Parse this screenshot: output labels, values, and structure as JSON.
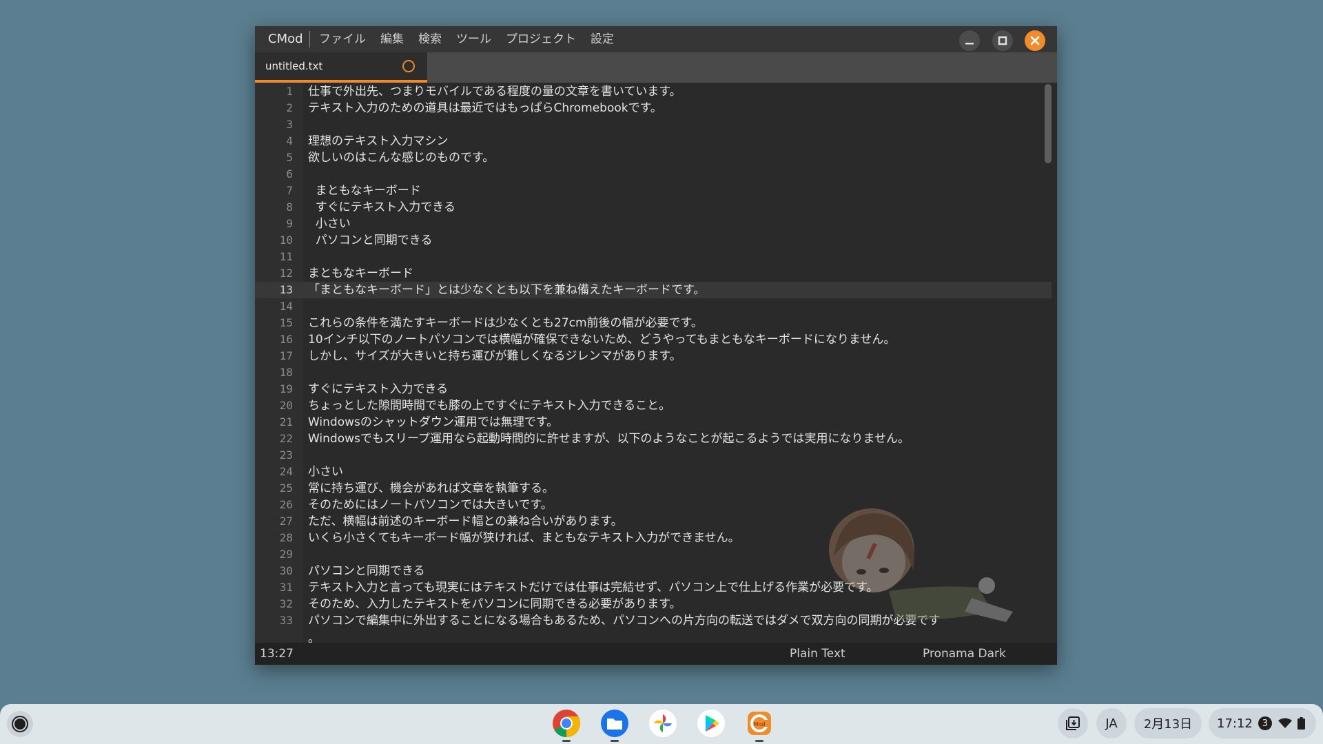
{
  "window": {
    "app_name": "CMod",
    "menu": [
      "ファイル",
      "編集",
      "検索",
      "ツール",
      "プロジェクト",
      "設定"
    ],
    "controls": {
      "minimize": "minimize-icon",
      "maximize": "maximize-icon",
      "close": "close-icon"
    }
  },
  "tabs": [
    {
      "title": "untitled.txt",
      "modified_indicator": "circle-icon"
    }
  ],
  "editor": {
    "current_line": 13,
    "lines": [
      {
        "n": "1",
        "text": "仕事で外出先、つまりモバイルである程度の量の文章を書いています。"
      },
      {
        "n": "2",
        "text": "テキスト入力のための道具は最近ではもっぱらChromebookです。"
      },
      {
        "n": "3",
        "text": ""
      },
      {
        "n": "4",
        "text": "理想のテキスト入力マシン"
      },
      {
        "n": "5",
        "text": "欲しいのはこんな感じのものです。"
      },
      {
        "n": "6",
        "text": ""
      },
      {
        "n": "7",
        "text": "  まともなキーボード"
      },
      {
        "n": "8",
        "text": "  すぐにテキスト入力できる"
      },
      {
        "n": "9",
        "text": "  小さい"
      },
      {
        "n": "10",
        "text": "  パソコンと同期できる"
      },
      {
        "n": "11",
        "text": ""
      },
      {
        "n": "12",
        "text": "まともなキーボード"
      },
      {
        "n": "13",
        "text": "「まともなキーボード」とは少なくとも以下を兼ね備えたキーボードです。"
      },
      {
        "n": "14",
        "text": ""
      },
      {
        "n": "15",
        "text": "これらの条件を満たすキーボードは少なくとも27cm前後の幅が必要です。"
      },
      {
        "n": "16",
        "text": "10インチ以下のノートパソコンでは横幅が確保できないため、どうやってもまともなキーボードになりません。"
      },
      {
        "n": "17",
        "text": "しかし、サイズが大きいと持ち運びが難しくなるジレンマがあります。"
      },
      {
        "n": "18",
        "text": ""
      },
      {
        "n": "19",
        "text": "すぐにテキスト入力できる"
      },
      {
        "n": "20",
        "text": "ちょっとした隙間時間でも膝の上ですぐにテキスト入力できること。"
      },
      {
        "n": "21",
        "text": "Windowsのシャットダウン運用では無理です。"
      },
      {
        "n": "22",
        "text": "Windowsでもスリープ運用なら起動時間的に許せますが、以下のようなことが起こるようでは実用になりません。"
      },
      {
        "n": "23",
        "text": ""
      },
      {
        "n": "24",
        "text": "小さい"
      },
      {
        "n": "25",
        "text": "常に持ち運び、機会があれば文章を執筆する。"
      },
      {
        "n": "26",
        "text": "そのためにはノートパソコンでは大きいです。"
      },
      {
        "n": "27",
        "text": "ただ、横幅は前述のキーボード幅との兼ね合いがあります。"
      },
      {
        "n": "28",
        "text": "いくら小さくてもキーボード幅が狭ければ、まともなテキスト入力ができません。"
      },
      {
        "n": "29",
        "text": ""
      },
      {
        "n": "30",
        "text": "パソコンと同期できる"
      },
      {
        "n": "31",
        "text": "テキスト入力と言っても現実にはテキストだけでは仕事は完結せず、パソコン上で仕上げる作業が必要です。"
      },
      {
        "n": "32",
        "text": "そのため、入力したテキストをパソコンに同期できる必要があります。"
      },
      {
        "n": "33",
        "text": "パソコンで編集中に外出することになる場合もあるため、パソコンへの片方向の転送ではダメで双方向の同期が必要です"
      },
      {
        "n": "",
        "text": "。"
      }
    ],
    "scroll_fraction": 0.0
  },
  "status": {
    "cursor": "13:27",
    "mode": "Plain Text",
    "theme": "Pronama Dark"
  },
  "shelf": {
    "launcher": "launcher-icon",
    "apps": [
      "chrome-icon",
      "files-icon",
      "photos-icon",
      "play-store-icon",
      "cmod-icon"
    ],
    "tray": {
      "holding_space": "holding-space-icon",
      "ime": "JA",
      "date": "2月13日",
      "time": "17:12",
      "notifications": "3"
    }
  }
}
